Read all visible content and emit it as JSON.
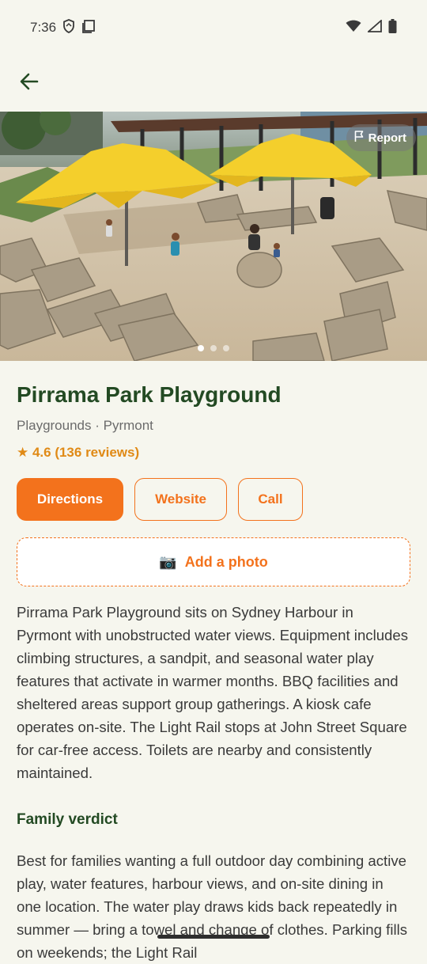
{
  "status_bar": {
    "time": "7:36"
  },
  "hero": {
    "report_label": "Report"
  },
  "place": {
    "name": "Pirrama Park Playground",
    "subtitle": "Playgrounds · Pyrmont",
    "rating": "★ 4.6 (136 reviews)"
  },
  "actions": {
    "directions": "Directions",
    "website": "Website",
    "call": "Call",
    "add_photo": "Add a photo",
    "add_photo_icon": "📷"
  },
  "description": "Pirrama Park Playground sits on Sydney Harbour in Pyrmont with unobstructed water views. Equipment includes climbing structures, a sandpit, and seasonal water play features that activate in warmer months. BBQ facilities and sheltered areas support group gatherings. A kiosk cafe operates on-site. The Light Rail stops at John Street Square for car-free access. Toilets are nearby and consistently maintained.",
  "verdict": {
    "heading": "Family verdict",
    "text": "Best for families wanting a full outdoor day combining active play, water features, harbour views, and on-site dining in one location. The water play draws kids back repeatedly in summer — bring a towel and change of clothes. Parking fills on weekends; the Light Rail"
  },
  "colors": {
    "accent": "#f3721c",
    "title": "#234a23",
    "rating": "#e08a16",
    "background": "#f6f6ee"
  }
}
